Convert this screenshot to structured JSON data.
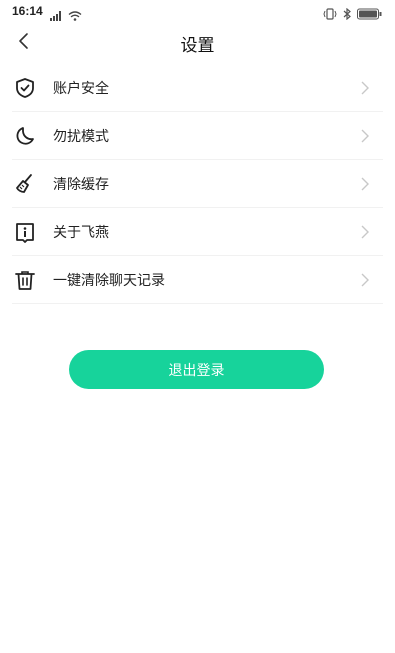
{
  "status": {
    "time": "16:14"
  },
  "nav": {
    "title": "设置"
  },
  "menu": [
    {
      "label": "账户安全",
      "icon": "shield-check-icon"
    },
    {
      "label": "勿扰模式",
      "icon": "moon-icon"
    },
    {
      "label": "清除缓存",
      "icon": "broom-icon"
    },
    {
      "label": "关于飞燕",
      "icon": "info-book-icon"
    },
    {
      "label": "一键清除聊天记录",
      "icon": "trash-icon"
    }
  ],
  "logout": {
    "label": "退出登录"
  },
  "colors": {
    "accent": "#17d39b"
  }
}
